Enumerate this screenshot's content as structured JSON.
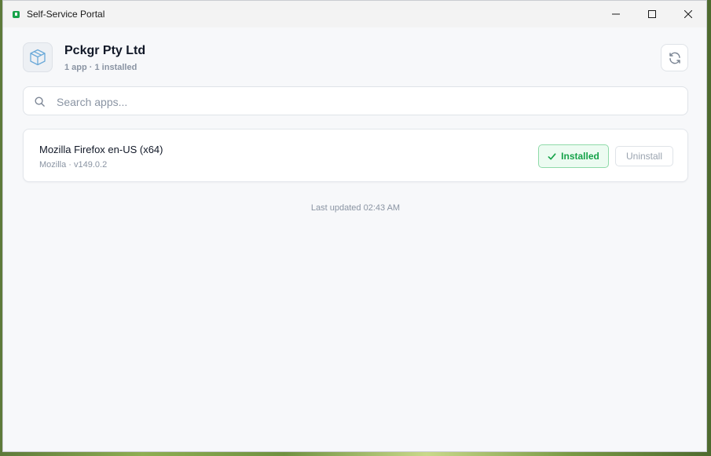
{
  "window": {
    "title": "Self-Service Portal",
    "app_icon": "portal-icon",
    "controls": {
      "minimize": "minimize-icon",
      "maximize": "maximize-icon",
      "close": "close-icon"
    }
  },
  "header": {
    "logo_icon": "package-box-icon",
    "company_name": "Pckgr Pty Ltd",
    "summary": "1 app · 1 installed",
    "refresh_icon": "refresh-icon"
  },
  "search": {
    "placeholder": "Search apps...",
    "value": "",
    "icon": "search-icon"
  },
  "apps": [
    {
      "name": "Mozilla Firefox en-US (x64)",
      "meta": "Mozilla · v149.0.2",
      "status_label": "Installed",
      "status_icon": "check-icon",
      "action_label": "Uninstall"
    }
  ],
  "footer": {
    "last_updated": "Last updated 02:43 AM"
  },
  "colors": {
    "accent_green": "#16a34a",
    "installed_bg": "#ecfbf1",
    "installed_border": "#8fdaa9",
    "muted_text": "#8a94a3",
    "background": "#f7f8fa"
  }
}
